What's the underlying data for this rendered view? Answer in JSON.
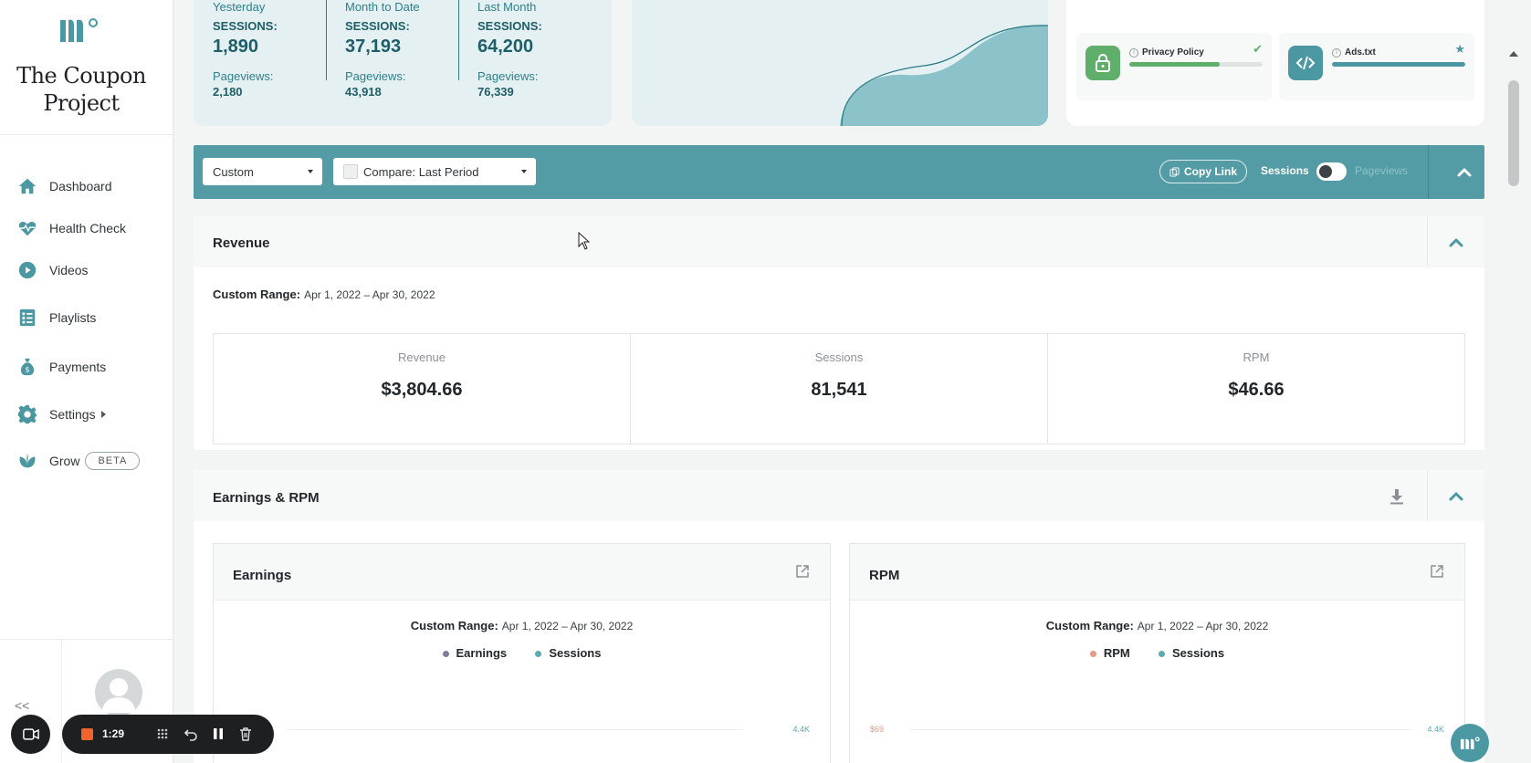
{
  "sidebar": {
    "brand": "The Coupon Project",
    "items": [
      {
        "label": "Dashboard",
        "icon": "home-icon"
      },
      {
        "label": "Health Check",
        "icon": "heartbeat-icon"
      },
      {
        "label": "Videos",
        "icon": "play-circle-icon"
      },
      {
        "label": "Playlists",
        "icon": "list-icon"
      },
      {
        "label": "Payments",
        "icon": "money-bag-icon"
      },
      {
        "label": "Settings",
        "icon": "gear-icon"
      },
      {
        "label": "Grow",
        "icon": "leaf-icon",
        "badge": "BETA"
      }
    ],
    "collapse_label": "<<"
  },
  "stats": [
    {
      "period": "Yesterday",
      "sessions_label": "SESSIONS:",
      "sessions": "1,890",
      "pageviews_label": "Pageviews:",
      "pageviews": "2,180"
    },
    {
      "period": "Month to Date",
      "sessions_label": "SESSIONS:",
      "sessions": "37,193",
      "pageviews_label": "Pageviews:",
      "pageviews": "43,918"
    },
    {
      "period": "Last Month",
      "sessions_label": "SESSIONS:",
      "sessions": "64,200",
      "pageviews_label": "Pageviews:",
      "pageviews": "76,339"
    }
  ],
  "health": [
    {
      "label": "Privacy Policy",
      "progress": 0.68,
      "status": "check",
      "icon": "lock-icon",
      "color": "#5fae6a"
    },
    {
      "label": "Ads.txt",
      "progress": 1.0,
      "status": "star",
      "icon": "code-icon",
      "color": "#4b98a3"
    }
  ],
  "filter": {
    "range_select": "Custom",
    "compare_select": "Compare: Last Period",
    "copy_link": "Copy Link",
    "toggle_left": "Sessions",
    "toggle_right": "Pageviews"
  },
  "revenue": {
    "title": "Revenue",
    "range_label": "Custom Range:",
    "range_value": "Apr 1, 2022 – Apr 30, 2022",
    "metrics": [
      {
        "label": "Revenue",
        "value": "$3,804.66"
      },
      {
        "label": "Sessions",
        "value": "81,541"
      },
      {
        "label": "RPM",
        "value": "$46.66"
      }
    ]
  },
  "earnings_rpm": {
    "title": "Earnings & RPM",
    "charts": [
      {
        "title": "Earnings",
        "range_label": "Custom Range:",
        "range_value": "Apr 1, 2022 – Apr 30, 2022",
        "legend": [
          "Earnings",
          "Sessions"
        ],
        "legend_colors": [
          "#7b7f9e",
          "#5fa9b1"
        ],
        "left_axis": "",
        "right_axis": "4.4K"
      },
      {
        "title": "RPM",
        "range_label": "Custom Range:",
        "range_value": "Apr 1, 2022 – Apr 30, 2022",
        "legend": [
          "RPM",
          "Sessions"
        ],
        "legend_colors": [
          "#e59a86",
          "#5fa9b1"
        ],
        "left_axis": "$69",
        "right_axis": "4.4K"
      }
    ]
  },
  "recorder": {
    "time": "1:29"
  },
  "colors": {
    "accent": "#549ca5",
    "card_bg": "#e4f0f1",
    "brand_dark": "#1e5e68"
  }
}
